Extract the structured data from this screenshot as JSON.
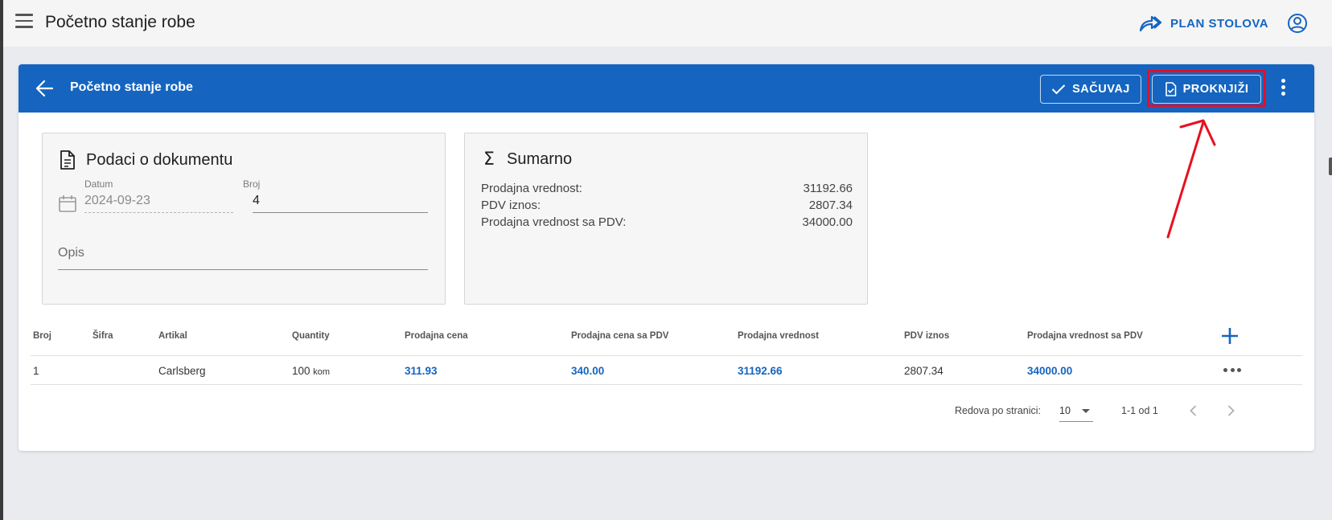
{
  "app": {
    "title": "Početno stanje robe",
    "plan_label": "PLAN STOLOVA"
  },
  "card": {
    "title": "Početno stanje robe",
    "save_label": "SAČUVAJ",
    "post_label": "PROKNJIŽI"
  },
  "document_panel": {
    "title": "Podaci o dokumentu",
    "date_label": "Datum",
    "date_value": "2024-09-23",
    "number_label": "Broj",
    "number_value": "4",
    "description_label": "Opis"
  },
  "summary_panel": {
    "title": "Sumarno",
    "symbol": "Σ",
    "rows": [
      {
        "label": "Prodajna vrednost:",
        "value": "31192.66"
      },
      {
        "label": "PDV iznos:",
        "value": "2807.34"
      },
      {
        "label": "Prodajna vrednost sa PDV:",
        "value": "34000.00"
      }
    ]
  },
  "table": {
    "headers": [
      "Broj",
      "Šifra",
      "Artikal",
      "Quantity",
      "Prodajna cena",
      "Prodajna cena sa PDV",
      "Prodajna vrednost",
      "PDV iznos",
      "Prodajna vrednost sa PDV"
    ],
    "rows": [
      {
        "broj": "1",
        "sifra": "",
        "artikal": "Carlsberg",
        "quantity": "100",
        "unit": "kom",
        "prodajna_cena": "311.93",
        "prodajna_cena_pdv": "340.00",
        "prodajna_vrednost": "31192.66",
        "pdv_iznos": "2807.34",
        "prodajna_vrednost_pdv": "34000.00"
      }
    ]
  },
  "pagination": {
    "rows_per_page_label": "Redova po stranici:",
    "rows_per_page": "10",
    "range": "1-1 od 1"
  },
  "colors": {
    "primary": "#1565c0",
    "annotation": "#e0102a"
  },
  "icons": [
    "menu-icon",
    "share-arrow-icon",
    "account-circle-icon",
    "back-arrow-icon",
    "check-icon",
    "document-check-icon",
    "more-vert-icon",
    "document-icon",
    "sigma-icon",
    "calendar-icon",
    "plus-icon",
    "more-horiz-icon",
    "chevron-left-icon",
    "chevron-right-icon"
  ]
}
